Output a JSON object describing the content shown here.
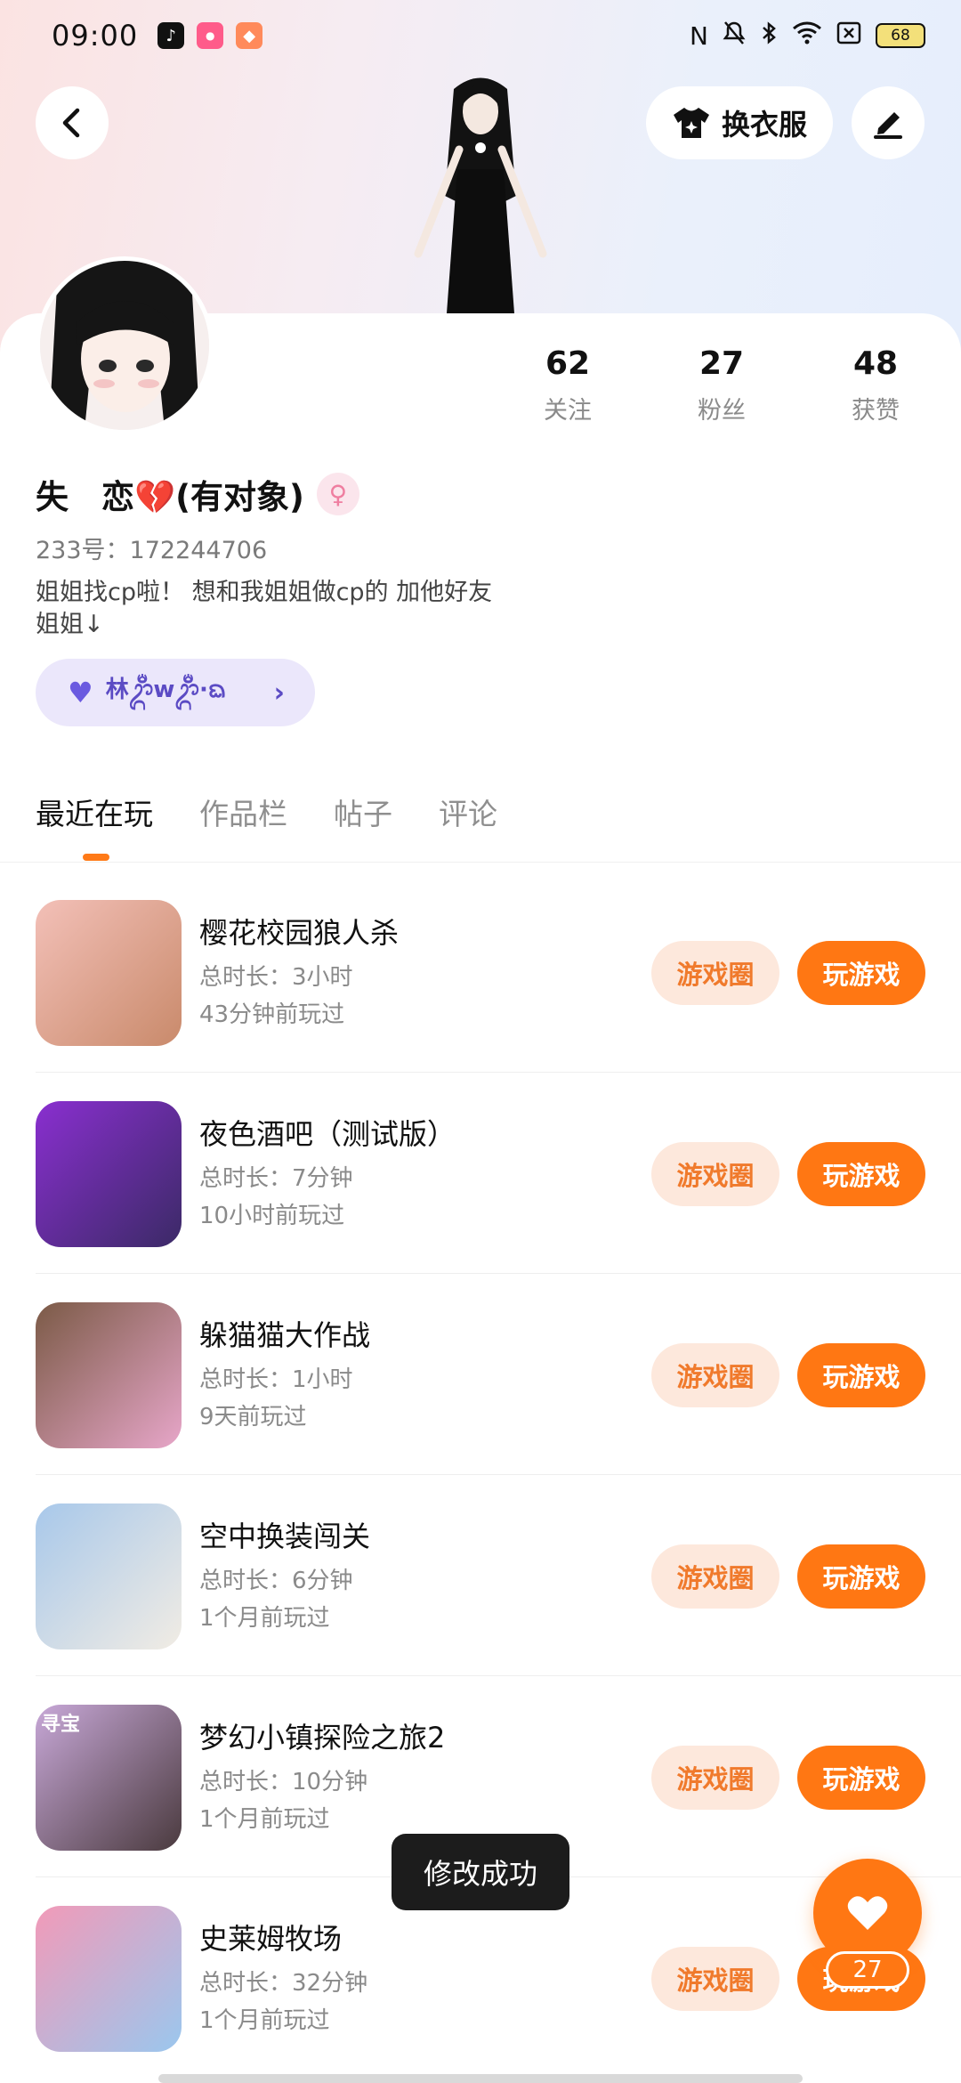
{
  "status_bar": {
    "time": "09:00",
    "battery": "68",
    "app_icons": [
      "tiktok-icon",
      "lele-app-icon",
      "game-controller-icon"
    ],
    "indicator_icons": [
      "nfc-icon",
      "mute-bell-icon",
      "bluetooth-icon",
      "wifi-icon",
      "sim-off-icon"
    ]
  },
  "header": {
    "outfit_label": "换衣服"
  },
  "profile": {
    "nickname": "失　恋💔(有对象)",
    "gender_symbol": "♀",
    "uid": "233号：172244706",
    "bio_line1": "姐姐找cp啦！ 想和我姐姐做cp的 加他好友",
    "bio_line2": "姐姐↓",
    "cp_chip_text": "林ᬊᬁwᬊᬁ·ᨳ"
  },
  "stats": [
    {
      "value": "62",
      "label": "关注"
    },
    {
      "value": "27",
      "label": "粉丝"
    },
    {
      "value": "48",
      "label": "获赞"
    }
  ],
  "tabs": [
    {
      "label": "最近在玩",
      "active": true
    },
    {
      "label": "作品栏",
      "active": false
    },
    {
      "label": "帖子",
      "active": false
    },
    {
      "label": "评论",
      "active": false
    }
  ],
  "games": [
    {
      "title": "樱花校园狼人杀",
      "duration": "总时长：3小时",
      "last_played": "43分钟前玩过",
      "circle_label": "游戏圈",
      "play_label": "玩游戏",
      "thumb_colors": [
        "#f3c0b8",
        "#c98a6b"
      ]
    },
    {
      "title": "夜色酒吧（测试版）",
      "duration": "总时长：7分钟",
      "last_played": "10小时前玩过",
      "circle_label": "游戏圈",
      "play_label": "玩游戏",
      "thumb_colors": [
        "#8a2fd0",
        "#3b2a66"
      ]
    },
    {
      "title": "躲猫猫大作战",
      "duration": "总时长：1小时",
      "last_played": "9天前玩过",
      "circle_label": "游戏圈",
      "play_label": "玩游戏",
      "thumb_colors": [
        "#7b5a46",
        "#e7a6c9"
      ]
    },
    {
      "title": "空中换装闯关",
      "duration": "总时长：6分钟",
      "last_played": "1个月前玩过",
      "circle_label": "游戏圈",
      "play_label": "玩游戏",
      "thumb_colors": [
        "#a8c8ea",
        "#f1ece4"
      ]
    },
    {
      "title": "梦幻小镇探险之旅2",
      "duration": "总时长：10分钟",
      "last_played": "1个月前玩过",
      "circle_label": "游戏圈",
      "play_label": "玩游戏",
      "thumb_colors": [
        "#c8a8d8",
        "#4a3a3e"
      ],
      "thumb_tag": "寻宝"
    },
    {
      "title": "史莱姆牧场",
      "duration": "总时长：32分钟",
      "last_played": "1个月前玩过",
      "circle_label": "游戏圈",
      "play_label": "玩游戏",
      "thumb_colors": [
        "#f29ab8",
        "#9ac7ee"
      ]
    }
  ],
  "toast": "修改成功",
  "like_fab": {
    "count": "27"
  }
}
